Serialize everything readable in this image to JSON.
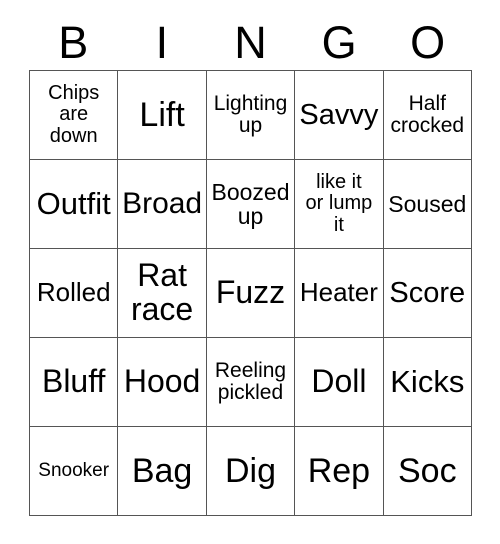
{
  "card": {
    "title": "BINGO",
    "columns": [
      "B",
      "I",
      "N",
      "G",
      "O"
    ],
    "grid_rows": 5,
    "grid_cols": 5,
    "border_color": "#555555",
    "text_color": "#000000",
    "background_color": "#ffffff"
  },
  "cells": [
    {
      "row": 1,
      "col": "B",
      "text": "Chips\nare\ndown",
      "size": "fs-20"
    },
    {
      "row": 1,
      "col": "I",
      "text": "Lift",
      "size": "fs-34"
    },
    {
      "row": 1,
      "col": "N",
      "text": "Lighting\nup",
      "size": "fs-21"
    },
    {
      "row": 1,
      "col": "G",
      "text": "Savvy",
      "size": "fs-29"
    },
    {
      "row": 1,
      "col": "O",
      "text": "Half\ncrocked",
      "size": "fs-21"
    },
    {
      "row": 2,
      "col": "B",
      "text": "Outfit",
      "size": "fs-31"
    },
    {
      "row": 2,
      "col": "I",
      "text": "Broad",
      "size": "fs-30"
    },
    {
      "row": 2,
      "col": "N",
      "text": "Boozed\nup",
      "size": "fs-23"
    },
    {
      "row": 2,
      "col": "G",
      "text": "like it\nor lump\nit",
      "size": "fs-20"
    },
    {
      "row": 2,
      "col": "O",
      "text": "Soused",
      "size": "fs-23"
    },
    {
      "row": 3,
      "col": "B",
      "text": "Rolled",
      "size": "fs-26"
    },
    {
      "row": 3,
      "col": "I",
      "text": "Rat\nrace",
      "size": "fs-32"
    },
    {
      "row": 3,
      "col": "N",
      "text": "Fuzz",
      "size": "fs-32"
    },
    {
      "row": 3,
      "col": "G",
      "text": "Heater",
      "size": "fs-26"
    },
    {
      "row": 3,
      "col": "O",
      "text": "Score",
      "size": "fs-29"
    },
    {
      "row": 4,
      "col": "B",
      "text": "Bluff",
      "size": "fs-32"
    },
    {
      "row": 4,
      "col": "I",
      "text": "Hood",
      "size": "fs-32"
    },
    {
      "row": 4,
      "col": "N",
      "text": "Reeling\npickled",
      "size": "fs-21"
    },
    {
      "row": 4,
      "col": "G",
      "text": "Doll",
      "size": "fs-32"
    },
    {
      "row": 4,
      "col": "O",
      "text": "Kicks",
      "size": "fs-31"
    },
    {
      "row": 5,
      "col": "B",
      "text": "Snooker",
      "size": "fs-19"
    },
    {
      "row": 5,
      "col": "I",
      "text": "Bag",
      "size": "fs-34"
    },
    {
      "row": 5,
      "col": "N",
      "text": "Dig",
      "size": "fs-34"
    },
    {
      "row": 5,
      "col": "G",
      "text": "Rep",
      "size": "fs-34"
    },
    {
      "row": 5,
      "col": "O",
      "text": "Soc",
      "size": "fs-34"
    }
  ]
}
